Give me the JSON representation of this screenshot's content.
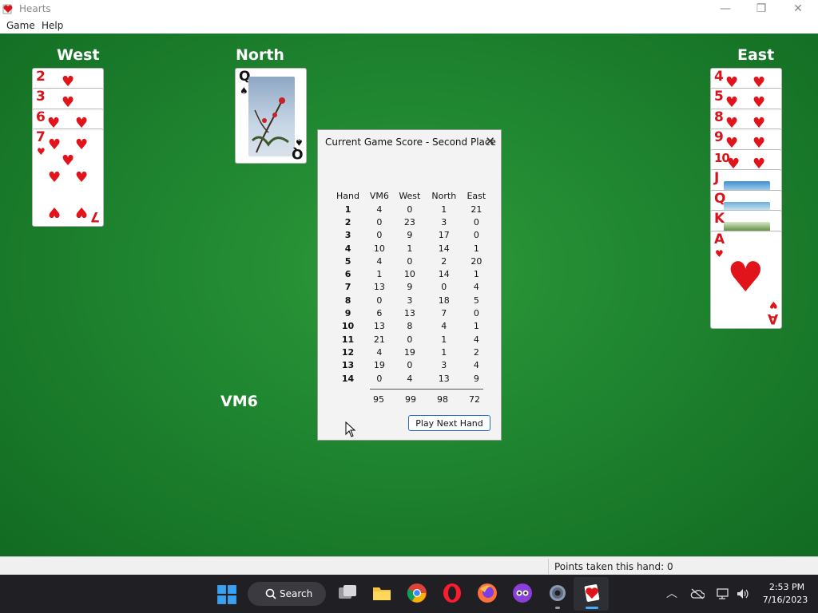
{
  "window": {
    "title": "Hearts",
    "minimize": "—",
    "maximize": "❐",
    "close": "✕"
  },
  "menu": {
    "game": "Game",
    "help": "Help"
  },
  "players": {
    "west": "West",
    "north": "North",
    "east": "East",
    "south": "VM6"
  },
  "cards": {
    "west": [
      "2",
      "3",
      "6",
      "7"
    ],
    "north": [
      "Q"
    ],
    "east": [
      "4",
      "5",
      "8",
      "9",
      "10",
      "J",
      "Q",
      "K",
      "A"
    ]
  },
  "dialog": {
    "title": "Current Game Score - Second Place",
    "close": "✕",
    "headers": [
      "Hand",
      "VM6",
      "West",
      "North",
      "East"
    ],
    "rows": [
      [
        "1",
        "4",
        "0",
        "1",
        "21"
      ],
      [
        "2",
        "0",
        "23",
        "3",
        "0"
      ],
      [
        "3",
        "0",
        "9",
        "17",
        "0"
      ],
      [
        "4",
        "10",
        "1",
        "14",
        "1"
      ],
      [
        "5",
        "4",
        "0",
        "2",
        "20"
      ],
      [
        "6",
        "1",
        "10",
        "14",
        "1"
      ],
      [
        "7",
        "13",
        "9",
        "0",
        "4"
      ],
      [
        "8",
        "0",
        "3",
        "18",
        "5"
      ],
      [
        "9",
        "6",
        "13",
        "7",
        "0"
      ],
      [
        "10",
        "13",
        "8",
        "4",
        "1"
      ],
      [
        "11",
        "21",
        "0",
        "1",
        "4"
      ],
      [
        "12",
        "4",
        "19",
        "1",
        "2"
      ],
      [
        "13",
        "19",
        "0",
        "3",
        "4"
      ],
      [
        "14",
        "0",
        "4",
        "13",
        "9"
      ]
    ],
    "totals": [
      "95",
      "99",
      "98",
      "72"
    ],
    "button": "Play Next Hand"
  },
  "status": {
    "points": "Points taken this hand: 0"
  },
  "taskbar": {
    "search": "Search",
    "time": "2:53 PM",
    "date": "7/16/2023",
    "apps": [
      "start-icon",
      "task-view-icon",
      "file-explorer-icon",
      "chrome-icon",
      "opera-icon",
      "firefox-icon",
      "app-icon",
      "settings-icon",
      "hearts-icon"
    ]
  },
  "colors": {
    "felt": "#1f8530",
    "heart_red": "#e2141b",
    "button_border": "#1f6fc7"
  }
}
